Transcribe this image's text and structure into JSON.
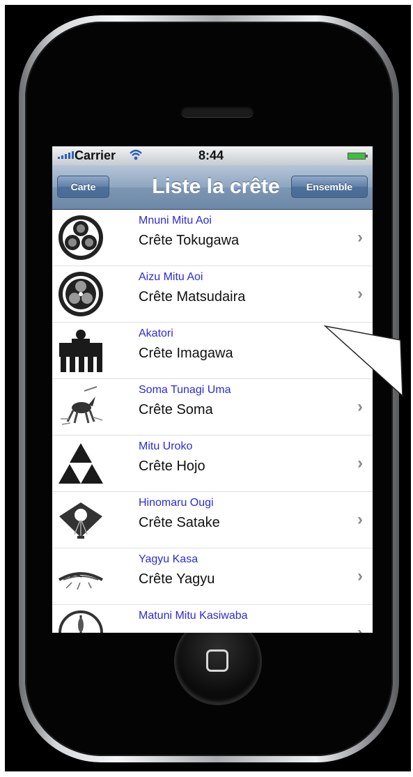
{
  "status_bar": {
    "carrier": "Carrier",
    "time": "8:44"
  },
  "nav_bar": {
    "left_button": "Carte",
    "title": "Liste la crête",
    "right_button": "Ensemble"
  },
  "rows": [
    {
      "subtitle": "Mnuni Mitu Aoi",
      "title": "Crête Tokugawa",
      "icon": "tokugawa-crest-icon"
    },
    {
      "subtitle": "Aizu Mitu Aoi",
      "title": "Crête Matsudaira",
      "icon": "matsudaira-crest-icon"
    },
    {
      "subtitle": "Akatori",
      "title": "Crête Imagawa",
      "icon": "imagawa-crest-icon"
    },
    {
      "subtitle": "Soma Tunagi Uma",
      "title": "Crête Soma",
      "icon": "soma-crest-icon"
    },
    {
      "subtitle": "Mitu Uroko",
      "title": "Crête Hojo",
      "icon": "hojo-crest-icon"
    },
    {
      "subtitle": "Hinomaru Ougi",
      "title": "Crête Satake",
      "icon": "satake-crest-icon"
    },
    {
      "subtitle": "Yagyu Kasa",
      "title": "Crête Yagyu",
      "icon": "yagyu-crest-icon"
    },
    {
      "subtitle": "Matuni Mitu Kasiwaba",
      "title": "",
      "icon": "kasiwaba-crest-icon"
    }
  ],
  "colors": {
    "subtitle": "#2b2bd8",
    "nav": "#7d96b3",
    "accent": "#4a6b94"
  }
}
